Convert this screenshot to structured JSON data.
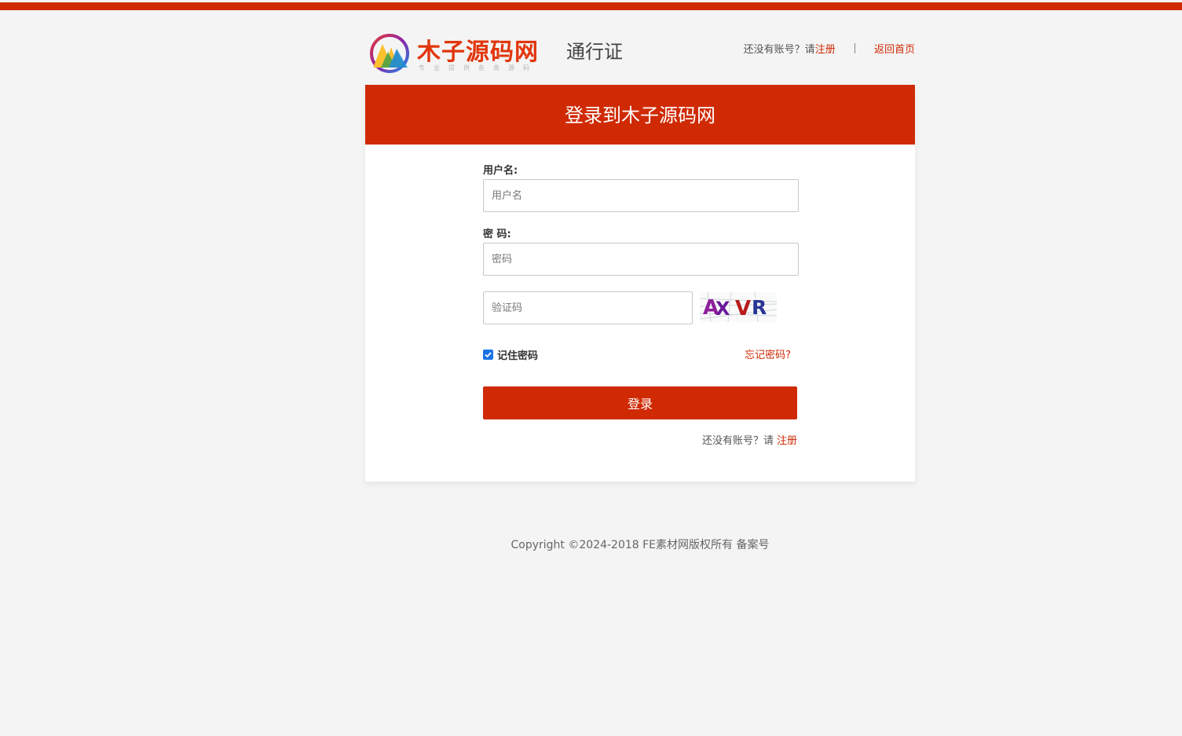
{
  "colors": {
    "brand_red": "#cf2a04",
    "background": "#f4f4f4",
    "panel": "#ffffff",
    "checkbox_blue": "#1a73e8"
  },
  "header": {
    "logo_name": "木子源码网",
    "logo_slogan": "专业提供各类源码",
    "pass_title": "通行证",
    "no_account_prompt": "还没有账号？请",
    "register_link": "注册",
    "home_link": "返回首页"
  },
  "panel": {
    "title": "登录到木子源码网"
  },
  "form": {
    "username_label": "用户名:",
    "username_placeholder": "用户名",
    "password_label": "密 码:",
    "password_placeholder": "密码",
    "captcha_placeholder": "验证码",
    "captcha_text": "AXVR",
    "remember_label": "记住密码",
    "remember_checked": true,
    "forgot_link": "忘记密码?",
    "login_button": "登录",
    "no_account_prompt": "还没有账号？请",
    "register_link": "注册"
  },
  "footer": {
    "copyright": "Copyright ©2024-2018 FE素材网版权所有 备案号"
  }
}
